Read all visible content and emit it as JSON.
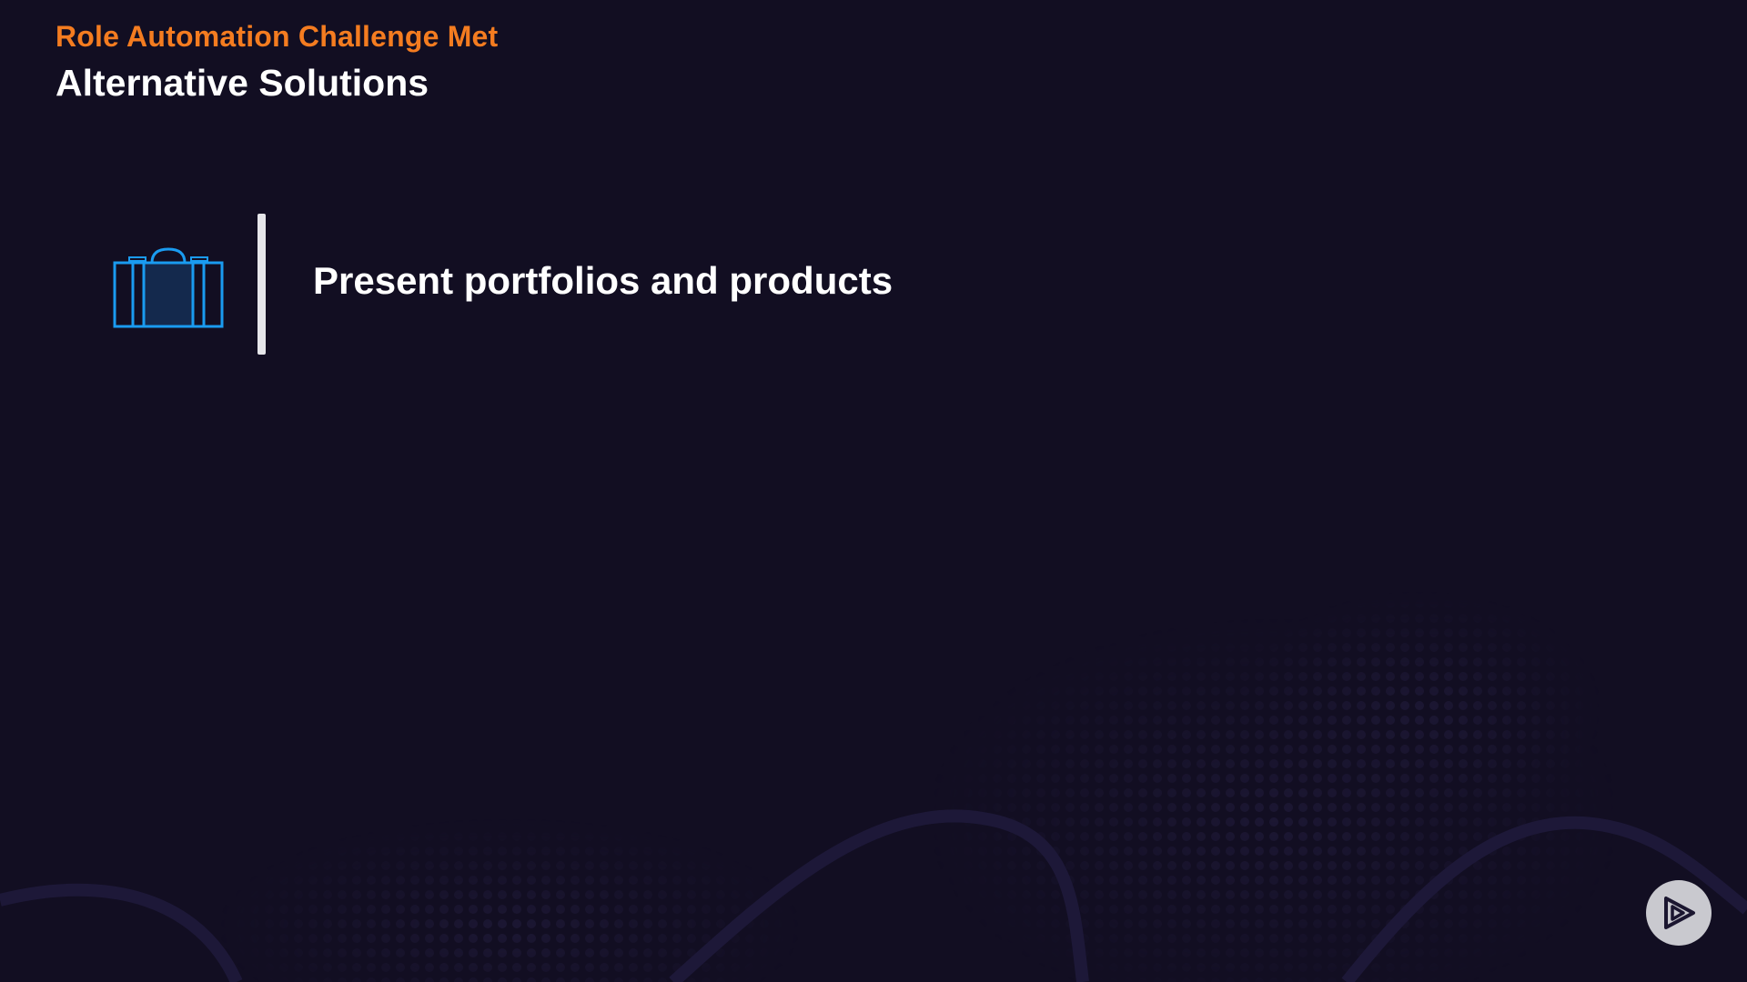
{
  "slide": {
    "kicker": "Role Automation Challenge Met",
    "title": "Alternative Solutions"
  },
  "items": [
    {
      "icon": "suitcase-icon",
      "text": "Present portfolios and products"
    }
  ],
  "player": {
    "icon": "play-logo-icon"
  },
  "colors": {
    "background": "#120e22",
    "kicker": "#f47c20",
    "title": "#ffffff",
    "icon_stroke": "#1a9bf0",
    "icon_fill": "#14294d",
    "divider": "#e6e6ea",
    "player_button": "#c9c9cf"
  }
}
